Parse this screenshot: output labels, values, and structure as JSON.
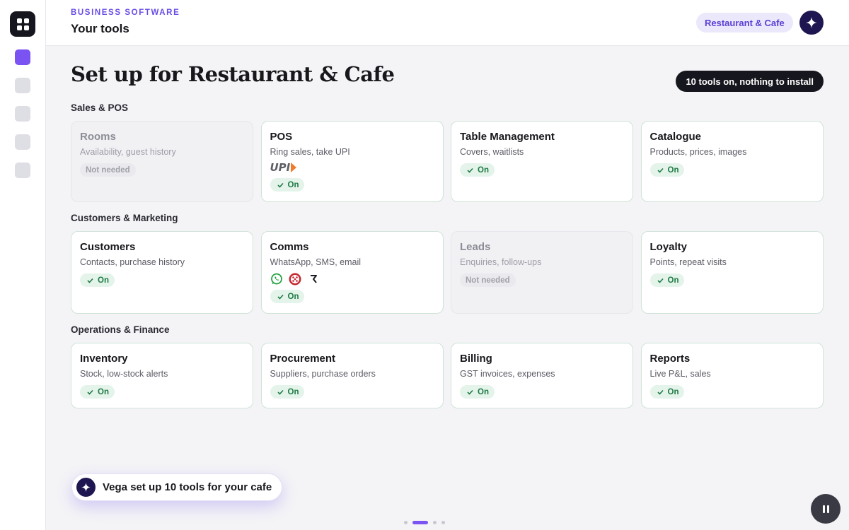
{
  "header": {
    "eyebrow": "BUSINESS SOFTWARE",
    "title": "Your tools",
    "industry": "Restaurant & Cafe"
  },
  "main": {
    "heading": "Set up for Restaurant & Cafe",
    "summary": "10 tools on, nothing to install"
  },
  "sections": [
    {
      "title": "Sales & POS",
      "tools": [
        {
          "name": "Rooms",
          "desc": "Availability, guest history",
          "status": "Not needed"
        },
        {
          "name": "POS",
          "desc": "Ring sales, take UPI",
          "status": "On",
          "integration": "UPI"
        },
        {
          "name": "Table Management",
          "desc": "Covers, waitlists",
          "status": "On"
        },
        {
          "name": "Catalogue",
          "desc": "Products, prices, images",
          "status": "On"
        }
      ]
    },
    {
      "title": "Customers & Marketing",
      "tools": [
        {
          "name": "Customers",
          "desc": "Contacts, purchase history",
          "status": "On"
        },
        {
          "name": "Comms",
          "desc": "WhatsApp, SMS, email",
          "status": "On",
          "channels": [
            "whatsapp-icon",
            "sms-icon",
            "payment-icon"
          ]
        },
        {
          "name": "Leads",
          "desc": "Enquiries, follow-ups",
          "status": "Not needed"
        },
        {
          "name": "Loyalty",
          "desc": "Points, repeat visits",
          "status": "On"
        }
      ]
    },
    {
      "title": "Operations & Finance",
      "tools": [
        {
          "name": "Inventory",
          "desc": "Stock, low-stock alerts",
          "status": "On"
        },
        {
          "name": "Procurement",
          "desc": "Suppliers, purchase orders",
          "status": "On"
        },
        {
          "name": "Billing",
          "desc": "GST invoices, expenses",
          "status": "On"
        },
        {
          "name": "Reports",
          "desc": "Live P&L, sales",
          "status": "On"
        }
      ]
    }
  ],
  "toast": {
    "text": "Vega set up 10 tools for your cafe"
  },
  "pager": {
    "count": 4,
    "active": 1
  },
  "colors": {
    "accent": "#7b53f2",
    "on_badge": "#1f7a45",
    "dark": "#16161e"
  }
}
